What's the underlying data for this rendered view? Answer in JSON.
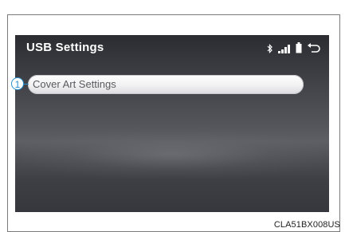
{
  "screen": {
    "title": "USB Settings",
    "status_icons": [
      "bluetooth-icon",
      "signal-icon",
      "battery-icon",
      "back-icon"
    ],
    "items": [
      {
        "label": "Cover Art Settings"
      }
    ]
  },
  "callout": {
    "number": "1"
  },
  "caption": "CLA51BX008US"
}
